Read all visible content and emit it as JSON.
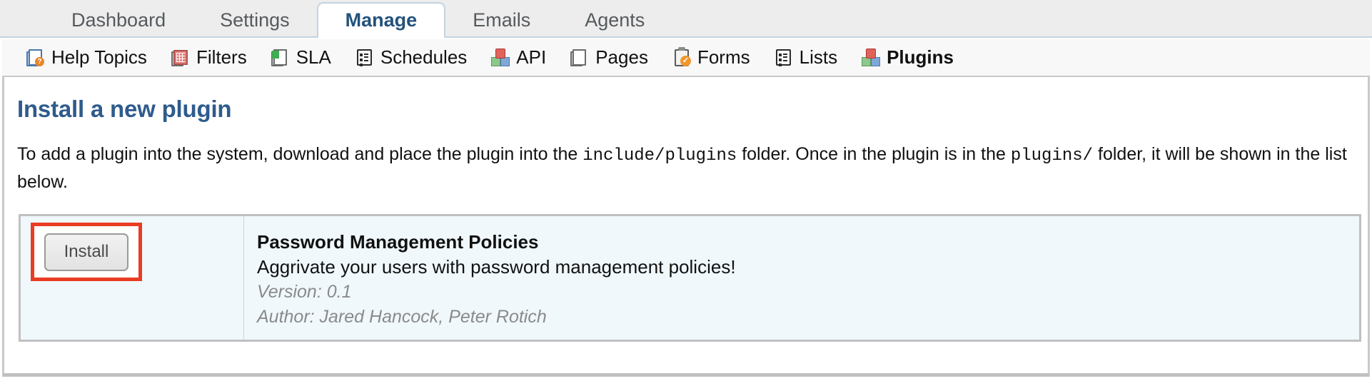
{
  "tabs": [
    {
      "label": "Dashboard",
      "active": false
    },
    {
      "label": "Settings",
      "active": false
    },
    {
      "label": "Manage",
      "active": true
    },
    {
      "label": "Emails",
      "active": false
    },
    {
      "label": "Agents",
      "active": false
    }
  ],
  "subnav": [
    {
      "label": "Help Topics",
      "icon": "help-topics-icon",
      "active": false
    },
    {
      "label": "Filters",
      "icon": "filters-icon",
      "active": false
    },
    {
      "label": "SLA",
      "icon": "sla-icon",
      "active": false
    },
    {
      "label": "Schedules",
      "icon": "schedules-icon",
      "active": false
    },
    {
      "label": "API",
      "icon": "api-icon",
      "active": false
    },
    {
      "label": "Pages",
      "icon": "pages-icon",
      "active": false
    },
    {
      "label": "Forms",
      "icon": "forms-icon",
      "active": false
    },
    {
      "label": "Lists",
      "icon": "lists-icon",
      "active": false
    },
    {
      "label": "Plugins",
      "icon": "plugins-icon",
      "active": true
    }
  ],
  "main": {
    "title": "Install a new plugin",
    "description": {
      "part1": "To add a plugin into the system, download and place the plugin into the ",
      "code1": "include/plugins",
      "part2": " folder. Once in the plugin is in the ",
      "code2": "plugins/",
      "part3": " folder, it will be shown in the list below."
    }
  },
  "plugins": [
    {
      "action_label": "Install",
      "name": "Password Management Policies",
      "description": "Aggrivate your users with password management policies!",
      "version": "Version: 0.1",
      "author": "Author: Jared Hancock, Peter Rotich"
    }
  ],
  "colors": {
    "accent_blue": "#2f5b8c",
    "active_tab_text": "#23527c",
    "highlight_red": "#ea3c23",
    "row_background": "#f0f8fc",
    "tabbar_background": "#ededed"
  }
}
